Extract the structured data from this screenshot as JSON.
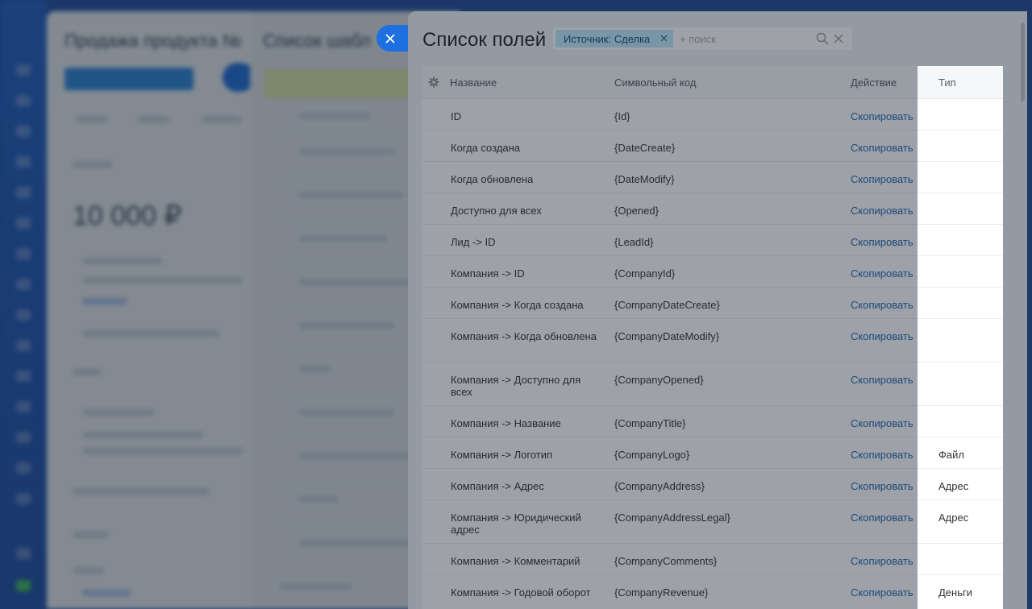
{
  "background": {
    "panel1_title": "Продажа продукта №",
    "panel1_amount": "10 000 ₽",
    "panel2_title": "Список шабл"
  },
  "close_tab": {
    "icon": "close-icon"
  },
  "slider": {
    "title": "Список полей",
    "filter": {
      "chip_label": "Источник: Сделка",
      "placeholder": "+ поиск"
    }
  },
  "table": {
    "headers": {
      "name": "Название",
      "code": "Символьный код",
      "action": "Действие",
      "type": "Тип"
    },
    "rows": [
      {
        "name": "ID",
        "code": "{Id}",
        "action": "Скопировать",
        "type": ""
      },
      {
        "name": "Когда создана",
        "code": "{DateCreate}",
        "action": "Скопировать",
        "type": ""
      },
      {
        "name": "Когда обновлена",
        "code": "{DateModify}",
        "action": "Скопировать",
        "type": ""
      },
      {
        "name": "Доступно для всех",
        "code": "{Opened}",
        "action": "Скопировать",
        "type": ""
      },
      {
        "name": "Лид -> ID",
        "code": "{LeadId}",
        "action": "Скопировать",
        "type": ""
      },
      {
        "name": "Компания -> ID",
        "code": "{CompanyId}",
        "action": "Скопировать",
        "type": ""
      },
      {
        "name": "Компания -> Когда создана",
        "code": "{CompanyDateCreate}",
        "action": "Скопировать",
        "type": ""
      },
      {
        "name": "Компания -> Когда обновлена",
        "code": "{CompanyDateModify}",
        "action": "Скопировать",
        "type": ""
      },
      {
        "name": "Компания -> Доступно для всех",
        "code": "{CompanyOpened}",
        "action": "Скопировать",
        "type": ""
      },
      {
        "name": "Компания -> Название",
        "code": "{CompanyTitle}",
        "action": "Скопировать",
        "type": ""
      },
      {
        "name": "Компания -> Логотип",
        "code": "{CompanyLogo}",
        "action": "Скопировать",
        "type": "Файл"
      },
      {
        "name": "Компания -> Адрес",
        "code": "{CompanyAddress}",
        "action": "Скопировать",
        "type": "Адрес"
      },
      {
        "name": "Компания -> Юридический адрес",
        "code": "{CompanyAddressLegal}",
        "action": "Скопировать",
        "type": "Адрес"
      },
      {
        "name": "Компания -> Комментарий",
        "code": "{CompanyComments}",
        "action": "Скопировать",
        "type": ""
      },
      {
        "name": "Компания -> Годовой оборот",
        "code": "{CompanyRevenue}",
        "action": "Скопировать",
        "type": "Деньги"
      }
    ]
  }
}
